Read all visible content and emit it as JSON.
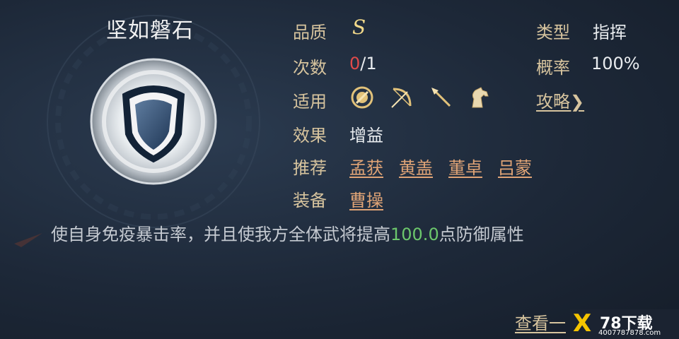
{
  "skill": {
    "name": "坚如磐石",
    "icon": "shield-icon"
  },
  "attributes": {
    "quality_label": "品质",
    "quality_value": "S",
    "count_label": "次数",
    "count_used": "0",
    "count_total": "/1",
    "usable_label": "适用",
    "usable_icons": [
      "shield-ring-icon",
      "bow-icon",
      "spear-icon",
      "horse-icon"
    ],
    "effect_label": "效果",
    "effect_value": "增益",
    "recommend_label": "推荐",
    "recommend_generals": [
      "孟获",
      "黄盖",
      "董卓",
      "吕蒙"
    ],
    "equip_label": "装备",
    "equip_general": "曹操",
    "type_label": "类型",
    "type_value": "指挥",
    "rate_label": "概率",
    "rate_value": "100%",
    "guide_link": "攻略❯"
  },
  "description": {
    "text_before": "使自身免疫暴击率，并且使我方全体武将提高",
    "number": "100.0",
    "text_after": "点防御属性"
  },
  "footer": {
    "more_link": "查看一"
  },
  "watermark": {
    "logo": "X",
    "title": "78下载",
    "site": "4007787878.com"
  },
  "colors": {
    "background": "#1d2838",
    "label": "#d7c49e",
    "link": "#e0a476",
    "highlight_number": "#6cc76c",
    "count_used": "#e04a4a",
    "grade": "#f2d98a"
  }
}
